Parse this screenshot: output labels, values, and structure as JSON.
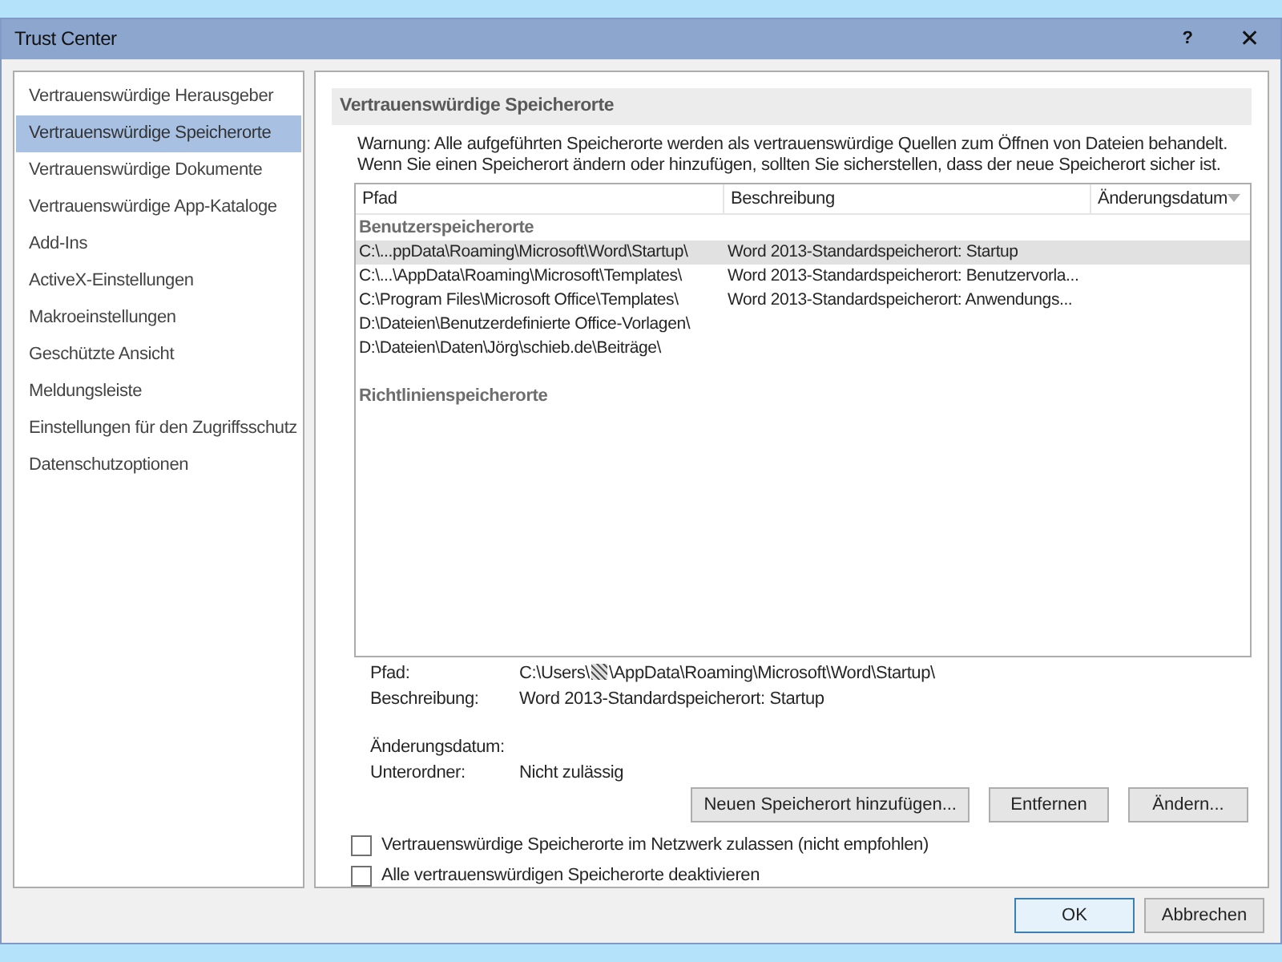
{
  "window": {
    "title": "Trust Center",
    "help": "?",
    "close": "✕"
  },
  "sidebar": {
    "items": [
      {
        "label": "Vertrauenswürdige Herausgeber",
        "selected": false
      },
      {
        "label": "Vertrauenswürdige Speicherorte",
        "selected": true
      },
      {
        "label": "Vertrauenswürdige Dokumente",
        "selected": false
      },
      {
        "label": "Vertrauenswürdige App-Kataloge",
        "selected": false
      },
      {
        "label": "Add-Ins",
        "selected": false
      },
      {
        "label": "ActiveX-Einstellungen",
        "selected": false
      },
      {
        "label": "Makroeinstellungen",
        "selected": false
      },
      {
        "label": "Geschützte Ansicht",
        "selected": false
      },
      {
        "label": "Meldungsleiste",
        "selected": false
      },
      {
        "label": "Einstellungen für den Zugriffsschutz",
        "selected": false
      },
      {
        "label": "Datenschutzoptionen",
        "selected": false
      }
    ]
  },
  "section": {
    "title": "Vertrauenswürdige Speicherorte",
    "warning": "Warnung: Alle aufgeführten Speicherorte werden als vertrauenswürdige Quellen zum Öffnen von Dateien behandelt. Wenn Sie einen Speicherort ändern oder hinzufügen, sollten Sie sicherstellen, dass der neue Speicherort sicher ist."
  },
  "table": {
    "columns": [
      "Pfad",
      "Beschreibung",
      "Änderungsdatum"
    ],
    "groups": [
      {
        "title": "Benutzerspeicherorte",
        "rows": [
          {
            "path": "C:\\...ppData\\Roaming\\Microsoft\\Word\\Startup\\",
            "description": "Word 2013-Standardspeicherort: Startup",
            "selected": true
          },
          {
            "path": "C:\\...\\AppData\\Roaming\\Microsoft\\Templates\\",
            "description": "Word 2013-Standardspeicherort: Benutzervorla...",
            "selected": false
          },
          {
            "path": "C:\\Program Files\\Microsoft Office\\Templates\\",
            "description": "Word 2013-Standardspeicherort: Anwendungs...",
            "selected": false
          },
          {
            "path": "D:\\Dateien\\Benutzerdefinierte Office-Vorlagen\\",
            "description": "",
            "selected": false
          },
          {
            "path": "D:\\Dateien\\Daten\\Jörg\\schieb.de\\Beiträge\\",
            "description": "",
            "selected": false
          }
        ]
      },
      {
        "title": "Richtlinienspeicherorte"
      }
    ]
  },
  "details": {
    "path_label": "Pfad:",
    "path_start": "C:\\Users\\",
    "path_redacted": true,
    "path_end": "\\AppData\\Roaming\\Microsoft\\Word\\Startup\\",
    "description_label": "Beschreibung:",
    "description": "Word 2013-Standardspeicherort: Startup",
    "date_label": "Änderungsdatum:",
    "subfolders_label": "Unterordner:",
    "subfolders": "Nicht zulässig"
  },
  "actions": [
    "Neuen Speicherort hinzufügen...",
    "Entfernen",
    "Ändern..."
  ],
  "options": [
    {
      "label": "Vertrauenswürdige Speicherorte im Netzwerk zulassen (nicht empfohlen)",
      "checked": false
    },
    {
      "label": "Alle vertrauenswürdigen Speicherorte deaktivieren",
      "checked": false
    }
  ],
  "buttons": [
    {
      "label": "OK",
      "default": true
    },
    {
      "label": "Abbrechen",
      "default": false
    }
  ]
}
